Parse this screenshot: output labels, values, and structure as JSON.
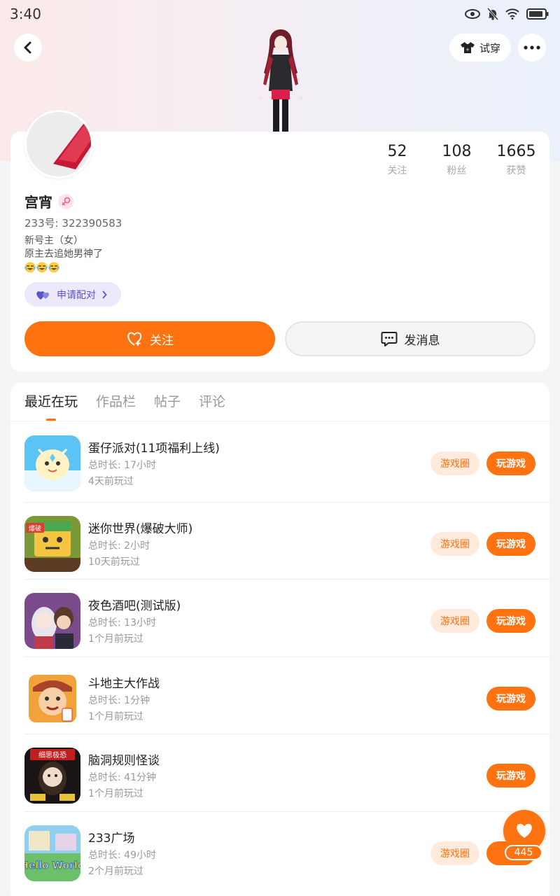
{
  "status_bar": {
    "time": "3:40"
  },
  "header": {
    "try_on_label": "试穿"
  },
  "profile": {
    "name": "宫宵",
    "uid": "233号: 322390583",
    "bio_line1": "新号主（女）",
    "bio_line2": "原主去追她男神了",
    "pair_label": "申请配对",
    "follow_label": "关注",
    "message_label": "发消息",
    "stats": [
      {
        "value": "52",
        "label": "关注"
      },
      {
        "value": "108",
        "label": "粉丝"
      },
      {
        "value": "1665",
        "label": "获赞"
      }
    ]
  },
  "tabs": [
    {
      "label": "最近在玩",
      "active": true
    },
    {
      "label": "作品栏",
      "active": false
    },
    {
      "label": "帖子",
      "active": false
    },
    {
      "label": "评论",
      "active": false
    }
  ],
  "games": [
    {
      "name": "蛋仔派对(11项福利上线)",
      "duration": "总时长: 17小时",
      "last_played": "4天前玩过",
      "circle_label": "游戏圈",
      "play_label": "玩游戏"
    },
    {
      "name": "迷你世界(爆破大师)",
      "duration": "总时长: 2小时",
      "last_played": "10天前玩过",
      "circle_label": "游戏圈",
      "play_label": "玩游戏"
    },
    {
      "name": "夜色酒吧(测试版)",
      "duration": "总时长: 13小时",
      "last_played": "1个月前玩过",
      "circle_label": "游戏圈",
      "play_label": "玩游戏"
    },
    {
      "name": "斗地主大作战",
      "duration": "总时长: 1分钟",
      "last_played": "1个月前玩过",
      "circle_label": "",
      "play_label": "玩游戏"
    },
    {
      "name": "脑洞规则怪谈",
      "duration": "总时长: 41分钟",
      "last_played": "1个月前玩过",
      "circle_label": "",
      "play_label": "玩游戏"
    },
    {
      "name": "233广场",
      "duration": "总时长: 49小时",
      "last_played": "2个月前玩过",
      "circle_label": "游戏圈",
      "play_label": "玩"
    }
  ],
  "game_icon_labels": {
    "miniworld": "爆破",
    "naodong": "细思极恐",
    "hello_world": "Hello World"
  },
  "like_fab": {
    "count": "445"
  },
  "colors": {
    "accent": "#ff7210",
    "pair_accent": "#5a55c9"
  }
}
